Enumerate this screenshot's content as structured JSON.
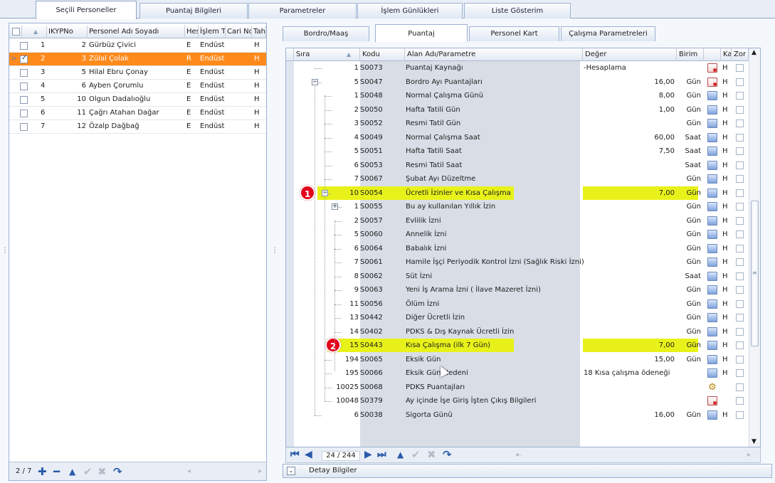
{
  "top_tabs": [
    {
      "label": "Seçili Personeller",
      "active": true
    },
    {
      "label": "Puantaj Bilgileri",
      "active": false
    },
    {
      "label": "Parametreler",
      "active": false
    },
    {
      "label": "İşlem Günlükleri",
      "active": false
    },
    {
      "label": "Liste Gösterim",
      "active": false
    }
  ],
  "left_grid": {
    "columns": [
      "IKYPNo",
      "Personel Adı Soyadı",
      "Hes",
      "İşlem T",
      "Cari No",
      "Tah"
    ],
    "rows": [
      {
        "index": "1",
        "ikyp": "2",
        "name": "Gürbüz Çivici",
        "hes": "E",
        "islem": "Endüst",
        "tah": "H",
        "checked": false,
        "selected": false
      },
      {
        "index": "2",
        "ikyp": "3",
        "name": "Zülal Çolak",
        "hes": "R",
        "islem": "Endüst",
        "tah": "H",
        "checked": true,
        "selected": true
      },
      {
        "index": "3",
        "ikyp": "5",
        "name": "Hilal Ebru Çonay",
        "hes": "E",
        "islem": "Endüst",
        "tah": "H",
        "checked": false,
        "selected": false
      },
      {
        "index": "4",
        "ikyp": "6",
        "name": "Ayben Çorumlu",
        "hes": "E",
        "islem": "Endüst",
        "tah": "H",
        "checked": false,
        "selected": false
      },
      {
        "index": "5",
        "ikyp": "10",
        "name": "Olgun Dadalıoğlu",
        "hes": "E",
        "islem": "Endüst",
        "tah": "H",
        "checked": false,
        "selected": false
      },
      {
        "index": "6",
        "ikyp": "11",
        "name": "Çağrı Atahan Dağar",
        "hes": "E",
        "islem": "Endüst",
        "tah": "H",
        "checked": false,
        "selected": false
      },
      {
        "index": "7",
        "ikyp": "12",
        "name": "Özalp Dağbağ",
        "hes": "E",
        "islem": "Endüst",
        "tah": "H",
        "checked": false,
        "selected": false
      }
    ],
    "record_counter": "2 / 7"
  },
  "right_tabs": [
    {
      "label": "Bordro/Maaş",
      "active": false
    },
    {
      "label": "Puantaj",
      "active": true
    },
    {
      "label": "Personel Kart",
      "active": false
    },
    {
      "label": "Çalışma Parametreleri",
      "active": false
    }
  ],
  "right_grid": {
    "columns": {
      "sira": "Sıra",
      "kodu": "Kodu",
      "alan": "Alan Adı/Parametre",
      "deger": "Değer",
      "birim": "Birim",
      "ka": "Ka",
      "zor": "Zor"
    },
    "rows": [
      {
        "sira": "1",
        "kodu": "S0073",
        "alan": "Puantaj Kaynağı",
        "deger": "-Hesaplama",
        "birim": "",
        "ka": "H",
        "icon": "red",
        "level": 1
      },
      {
        "sira": "5",
        "kodu": "S0047",
        "alan": "Bordro Ayı Puantajları",
        "deger": "16,00",
        "birim": "Gün",
        "ka": "H",
        "icon": "red",
        "level": 1,
        "expander": "−"
      },
      {
        "sira": "1",
        "kodu": "S0048",
        "alan": "Normal Çalışma Günü",
        "deger": "8,00",
        "birim": "Gün",
        "ka": "H",
        "icon": "blue",
        "level": 2
      },
      {
        "sira": "2",
        "kodu": "S0050",
        "alan": "Hafta Tatili Gün",
        "deger": "1,00",
        "birim": "Gün",
        "ka": "H",
        "icon": "blue",
        "level": 2
      },
      {
        "sira": "3",
        "kodu": "S0052",
        "alan": "Resmi Tatil Gün",
        "deger": "",
        "birim": "Gün",
        "ka": "H",
        "icon": "blue",
        "level": 2
      },
      {
        "sira": "4",
        "kodu": "S0049",
        "alan": "Normal Çalışma Saat",
        "deger": "60,00",
        "birim": "Saat",
        "ka": "H",
        "icon": "blue",
        "level": 2
      },
      {
        "sira": "5",
        "kodu": "S0051",
        "alan": "Hafta Tatili Saat",
        "deger": "7,50",
        "birim": "Saat",
        "ka": "H",
        "icon": "blue",
        "level": 2
      },
      {
        "sira": "6",
        "kodu": "S0053",
        "alan": "Resmi Tatil Saat",
        "deger": "",
        "birim": "Saat",
        "ka": "H",
        "icon": "blue",
        "level": 2
      },
      {
        "sira": "7",
        "kodu": "S0067",
        "alan": "Şubat Ayı Düzeltme",
        "deger": "",
        "birim": "Gün",
        "ka": "H",
        "icon": "blue",
        "level": 2
      },
      {
        "sira": "10",
        "kodu": "S0054",
        "alan": "Ücretli İzinler ve Kısa Çalışma",
        "deger": "7,00",
        "birim": "Gün",
        "ka": "H",
        "icon": "blue",
        "level": 2,
        "expander": "−",
        "highlight": true,
        "badge": "1"
      },
      {
        "sira": "1",
        "kodu": "S0055",
        "alan": "Bu ay kullanılan Yıllık İzin",
        "deger": "",
        "birim": "Gün",
        "ka": "H",
        "icon": "blue",
        "level": 3,
        "expander": "+"
      },
      {
        "sira": "2",
        "kodu": "S0057",
        "alan": "Evlilik İzni",
        "deger": "",
        "birim": "Gün",
        "ka": "H",
        "icon": "blue",
        "level": 3
      },
      {
        "sira": "5",
        "kodu": "S0060",
        "alan": "Annelik İzni",
        "deger": "",
        "birim": "Gün",
        "ka": "H",
        "icon": "blue",
        "level": 3
      },
      {
        "sira": "6",
        "kodu": "S0064",
        "alan": "Babalık İzni",
        "deger": "",
        "birim": "Gün",
        "ka": "H",
        "icon": "blue",
        "level": 3
      },
      {
        "sira": "7",
        "kodu": "S0061",
        "alan": "Hamile İşçi Periyodik Kontrol İzni (Sağlık Riski İzni)",
        "deger": "",
        "birim": "Gün",
        "ka": "H",
        "icon": "blue",
        "level": 3
      },
      {
        "sira": "8",
        "kodu": "S0062",
        "alan": "Süt İzni",
        "deger": "",
        "birim": "Saat",
        "ka": "H",
        "icon": "blue",
        "level": 3
      },
      {
        "sira": "9",
        "kodu": "S0063",
        "alan": "Yeni İş Arama İzni ( İlave Mazeret İzni)",
        "deger": "",
        "birim": "Gün",
        "ka": "H",
        "icon": "blue",
        "level": 3
      },
      {
        "sira": "11",
        "kodu": "S0056",
        "alan": "Ölüm İzni",
        "deger": "",
        "birim": "Gün",
        "ka": "H",
        "icon": "blue",
        "level": 3
      },
      {
        "sira": "13",
        "kodu": "S0442",
        "alan": "Diğer Ücretli İzin",
        "deger": "",
        "birim": "Gün",
        "ka": "H",
        "icon": "blue",
        "level": 3
      },
      {
        "sira": "14",
        "kodu": "S0402",
        "alan": "PDKS & Dış Kaynak Ücretli İzin",
        "deger": "",
        "birim": "Gün",
        "ka": "H",
        "icon": "blue",
        "level": 3
      },
      {
        "sira": "15",
        "kodu": "S0443",
        "alan": "Kısa Çalışma (ilk 7 Gün)",
        "deger": "7,00",
        "birim": "Gün",
        "ka": "H",
        "icon": "blue",
        "level": 3,
        "highlight": true,
        "badge": "2"
      },
      {
        "sira": "194",
        "kodu": "S0065",
        "alan": "Eksik Gün",
        "deger": "15,00",
        "birim": "Gün",
        "ka": "H",
        "icon": "blue",
        "level": 2
      },
      {
        "sira": "195",
        "kodu": "S0066",
        "alan": "Eksik Gün Nedeni",
        "deger": "18 Kısa çalışma ödeneği",
        "birim": "",
        "ka": "H",
        "icon": "blue",
        "level": 2
      },
      {
        "sira": "10025",
        "kodu": "S0068",
        "alan": "PDKS Puantajları",
        "deger": "",
        "birim": "",
        "ka": "",
        "icon": "gear",
        "level": 2
      },
      {
        "sira": "10048",
        "kodu": "S0379",
        "alan": "Ay içinde İşe Giriş İşten Çıkış Bilgileri",
        "deger": "",
        "birim": "",
        "ka": "",
        "icon": "red",
        "level": 2
      },
      {
        "sira": "6",
        "kodu": "S0038",
        "alan": "Sigorta Günü",
        "deger": "16,00",
        "birim": "Gün",
        "ka": "H",
        "icon": "blue",
        "level": 1
      }
    ],
    "record_counter": "24 / 244"
  },
  "detay_label": "Detay Bilgiler",
  "colors": {
    "selected_row": "#ff8a1c",
    "highlight": "#e8f21a",
    "badge": "#e4001b",
    "nav_blue": "#2b5aa9"
  }
}
